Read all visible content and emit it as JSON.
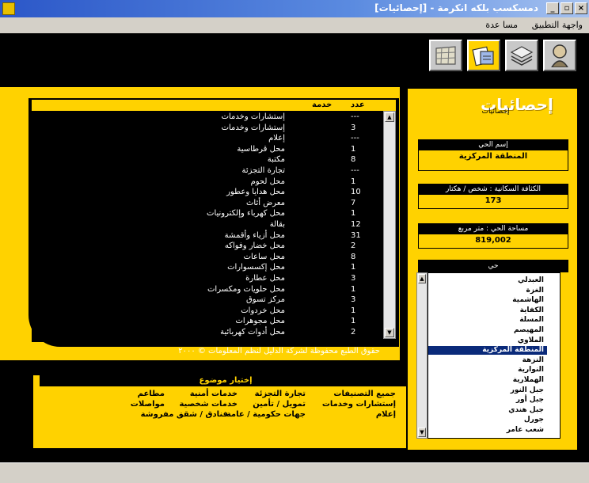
{
  "window": {
    "title": "دمسكسب بلكه انكرمة - [إحصائيات]",
    "buttons": {
      "close": "×",
      "maximize": "▫",
      "minimize": "_"
    }
  },
  "menu": {
    "items": [
      "واجهة التطبيق",
      "مسا عدة"
    ]
  },
  "toolbar": {
    "buttons": [
      {
        "name": "person-icon"
      },
      {
        "name": "layers-icon"
      },
      {
        "name": "statistics-icon",
        "active": true
      },
      {
        "name": "map-icon"
      }
    ]
  },
  "list": {
    "header": {
      "count": "عدد",
      "service": "خدمة"
    },
    "rows": [
      {
        "count": "---",
        "name": "إستشارات وخدمات"
      },
      {
        "count": "3",
        "name": "إستشارات وخدمات"
      },
      {
        "count": "---",
        "name": "إعلام"
      },
      {
        "count": "1",
        "name": "محل قرطاسية"
      },
      {
        "count": "8",
        "name": "مكتبة"
      },
      {
        "count": "---",
        "name": "تجارة التجزئة"
      },
      {
        "count": "1",
        "name": "محل لحوم"
      },
      {
        "count": "10",
        "name": "محل هدايا وعطور"
      },
      {
        "count": "7",
        "name": "معرض أثاث"
      },
      {
        "count": "1",
        "name": "محل كهرباء وإلكترونيات"
      },
      {
        "count": "12",
        "name": "بقالة"
      },
      {
        "count": "31",
        "name": "محل أزياء وأقمشة"
      },
      {
        "count": "2",
        "name": "محل خضار وفواكه"
      },
      {
        "count": "8",
        "name": "محل ساعات"
      },
      {
        "count": "1",
        "name": "محل إكسسوارات"
      },
      {
        "count": "3",
        "name": "محل عطارة"
      },
      {
        "count": "1",
        "name": "محل حلويات ومكسرات"
      },
      {
        "count": "3",
        "name": "مركز تسوق"
      },
      {
        "count": "1",
        "name": "محل خردوات"
      },
      {
        "count": "1",
        "name": "محل مجوهرات"
      },
      {
        "count": "2",
        "name": "محل أدوات كهربائية"
      }
    ],
    "copyright": "حقوق الطبع محفوظة لشركة الدليل لنظم المعلومات © ٢٠٠٠"
  },
  "topics": {
    "header": "إختيار موضوع",
    "items": [
      "جميع التصنيفات",
      "تجارة التجزئة",
      "خدمات أمنية",
      "مطاعم",
      "إستشارات وخدمات",
      "تمويل / تأمين",
      "خدمات شخصية",
      "مواصلات",
      "إعلام",
      "جهات حكومية / عامة",
      "فنادق / شقق مفروشة"
    ]
  },
  "stats": {
    "title": "إحصائيات",
    "subtitle": "إحصائيات",
    "neighborhood_label": "إسم الحي",
    "neighborhood_value": "المنطقة المركزية",
    "density_label": "الكثافة السكانية : شخص / هكتار",
    "density_value": "173",
    "area_label": "مساحة الحي : متر مربع",
    "area_value": "819,002"
  },
  "neighborhoods": {
    "header": "حي",
    "items": [
      "العبدلي",
      "الغزة",
      "الهاشمية",
      "الكفاية",
      "المسلة",
      "المهيصم",
      "الملاوي",
      "المنطقة المركزية",
      "النزهة",
      "النوارية",
      "الهملارية",
      "جبل النور",
      "جبل أور",
      "جبل هندي",
      "جورل",
      "شعب عامر"
    ],
    "selected": "المنطقة المركزية"
  },
  "colors": {
    "accent": "#ffd200",
    "background": "#000000",
    "selection": "#0a2a7a"
  }
}
